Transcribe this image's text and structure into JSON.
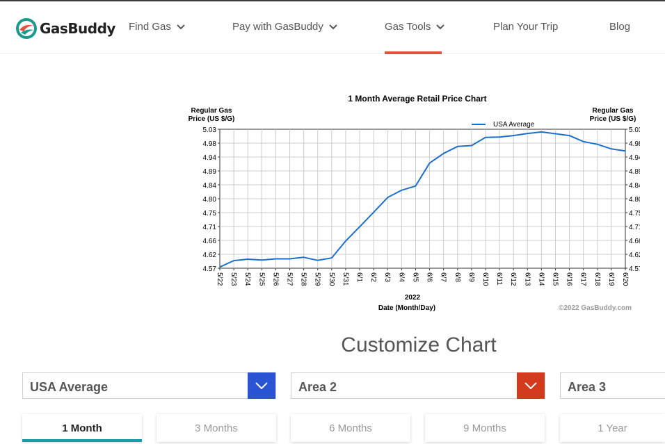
{
  "brand": {
    "name": "GasBuddy",
    "logo_icon": "gasbuddy-logo-icon"
  },
  "nav": {
    "items": [
      {
        "label": "Find Gas",
        "has_dropdown": true
      },
      {
        "label": "Pay with GasBuddy",
        "has_dropdown": true
      },
      {
        "label": "Gas Tools",
        "has_dropdown": true,
        "active": true
      },
      {
        "label": "Plan Your Trip",
        "has_dropdown": false
      },
      {
        "label": "Blog",
        "has_dropdown": false
      }
    ],
    "active_color": "#e0533d"
  },
  "chart_data": {
    "type": "line",
    "title": "1 Month Average Retail Price Chart",
    "ylabel_left": [
      "Regular Gas",
      "Price (US $/G)"
    ],
    "ylabel_right": [
      "Regular Gas",
      "Price (US $/G)"
    ],
    "xlabel_year": "2022",
    "xlabel": "Date (Month/Day)",
    "copyright": "©2022 GasBuddy.com",
    "legend_position": "top-right",
    "grid": true,
    "ylim": [
      4.57,
      5.03
    ],
    "yticks": [
      "5.03",
      "4.98",
      "4.94",
      "4.89",
      "4.84",
      "4.80",
      "4.75",
      "4.71",
      "4.66",
      "4.62",
      "4.57"
    ],
    "categories": [
      "5/22",
      "5/23",
      "5/24",
      "5/25",
      "5/26",
      "5/27",
      "5/28",
      "5/29",
      "5/30",
      "5/31",
      "6/1",
      "6/2",
      "6/3",
      "6/4",
      "6/5",
      "6/6",
      "6/7",
      "6/8",
      "6/9",
      "6/10",
      "6/11",
      "6/12",
      "6/13",
      "6/14",
      "6/15",
      "6/16",
      "6/17",
      "6/18",
      "6/19",
      "6/20"
    ],
    "series": [
      {
        "name": "USA Average",
        "color": "#1c6fc9",
        "values": [
          4.574,
          4.595,
          4.6,
          4.597,
          4.601,
          4.601,
          4.606,
          4.596,
          4.604,
          4.66,
          4.707,
          4.755,
          4.804,
          4.828,
          4.842,
          4.918,
          4.95,
          4.973,
          4.976,
          5.003,
          5.004,
          5.009,
          5.016,
          5.021,
          5.015,
          5.009,
          4.989,
          4.98,
          4.965,
          4.958
        ]
      }
    ]
  },
  "customize": {
    "title": "Customize Chart",
    "selects": [
      {
        "label": "USA Average",
        "button_color": "#2a54d2",
        "icon": "chevron-down-icon"
      },
      {
        "label": "Area 2",
        "button_color": "#d13b1c",
        "icon": "chevron-down-icon"
      },
      {
        "label": "Area 3"
      }
    ],
    "range_tabs": [
      {
        "label": "1 Month",
        "active": true
      },
      {
        "label": "3 Months"
      },
      {
        "label": "6 Months"
      },
      {
        "label": "9 Months"
      },
      {
        "label": "1 Year"
      }
    ],
    "active_tab_color": "#13a0a6"
  }
}
